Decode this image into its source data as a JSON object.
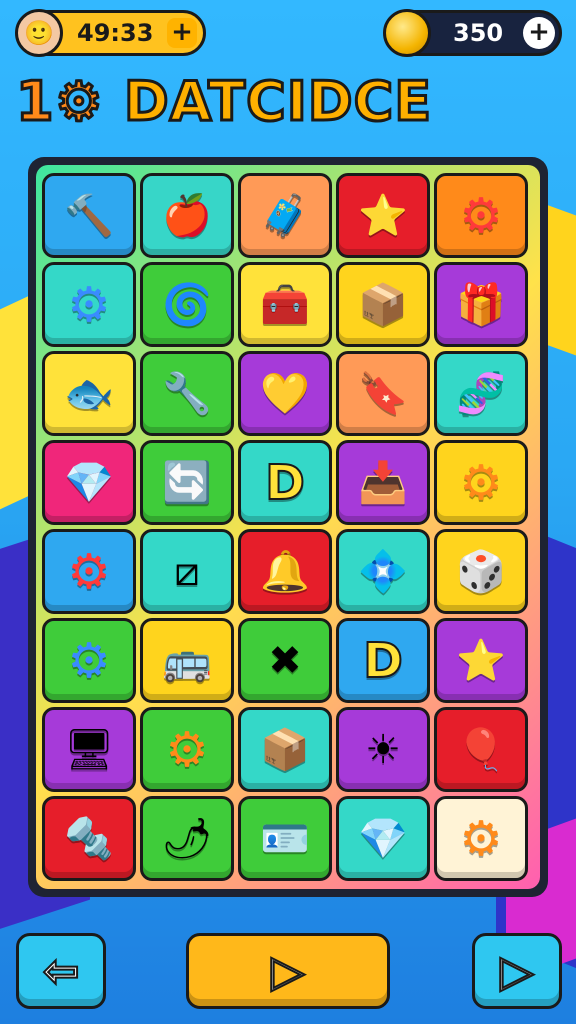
{
  "hud": {
    "timer": "49:33",
    "timer_plus": "+",
    "coins": "350",
    "coins_plus": "+"
  },
  "title": {
    "part1": "1",
    "part2": "DATCIDCE"
  },
  "controls": {
    "back": "⇦",
    "play": "▷",
    "next": "▷"
  },
  "tiles": [
    {
      "color": "#2fa8f0",
      "icon": "🔨",
      "name": "hammer-icon"
    },
    {
      "color": "#37d6c8",
      "icon": "🍎",
      "name": "apple-icon"
    },
    {
      "color": "#ff9a57",
      "icon": "🧳",
      "name": "suitcase-icon"
    },
    {
      "color": "#e61e2a",
      "icon": "⭐",
      "name": "star-gem-icon"
    },
    {
      "color": "#ff8a1a",
      "icon": "⚙",
      "name": "gear-icon"
    },
    {
      "color": "#34d8c8",
      "icon": "⚙",
      "name": "gear-icon"
    },
    {
      "color": "#3fcc3a",
      "icon": "🌀",
      "name": "swirl-icon"
    },
    {
      "color": "#ffe23a",
      "icon": "🧰",
      "name": "toolbox-icon"
    },
    {
      "color": "#ffd41d",
      "icon": "📦",
      "name": "box-icon"
    },
    {
      "color": "#a63ad9",
      "icon": "🎁",
      "name": "gift-icon"
    },
    {
      "color": "#ffe23a",
      "icon": "🐟",
      "name": "fish-icon"
    },
    {
      "color": "#3fcc3a",
      "icon": "🔧",
      "name": "wrench-icon"
    },
    {
      "color": "#a63ad9",
      "icon": "💛",
      "name": "heart-icon"
    },
    {
      "color": "#ff9a57",
      "icon": "🔖",
      "name": "tag-icon"
    },
    {
      "color": "#34d8c8",
      "icon": "🧬",
      "name": "molecule-icon"
    },
    {
      "color": "#f0267a",
      "icon": "💎",
      "name": "gem-icon"
    },
    {
      "color": "#3fcc3a",
      "icon": "🔄",
      "name": "scroll-icon"
    },
    {
      "color": "#34d8c8",
      "icon": "D",
      "name": "letter-d-icon"
    },
    {
      "color": "#a63ad9",
      "icon": "📥",
      "name": "box-lid-icon"
    },
    {
      "color": "#ffd41d",
      "icon": "⚙",
      "name": "gear-icon"
    },
    {
      "color": "#2fa8f0",
      "icon": "⚙",
      "name": "gear-icon"
    },
    {
      "color": "#34d8c8",
      "icon": "⧄",
      "name": "slash-box-icon"
    },
    {
      "color": "#e61e2a",
      "icon": "🔔",
      "name": "bell-icon"
    },
    {
      "color": "#34d8c8",
      "icon": "💠",
      "name": "crystal-icon"
    },
    {
      "color": "#ffd41d",
      "icon": "🎲",
      "name": "dice-icon"
    },
    {
      "color": "#3fcc3a",
      "icon": "⚙",
      "name": "gear-icon"
    },
    {
      "color": "#ffd41d",
      "icon": "🚌",
      "name": "bus-icon"
    },
    {
      "color": "#3fcc3a",
      "icon": "✖",
      "name": "crossed-tools-icon"
    },
    {
      "color": "#2fa8f0",
      "icon": "D",
      "name": "letter-d-icon"
    },
    {
      "color": "#a63ad9",
      "icon": "⭐",
      "name": "star-icon"
    },
    {
      "color": "#a63ad9",
      "icon": "🖥",
      "name": "monitor-icon"
    },
    {
      "color": "#3fcc3a",
      "icon": "⚙",
      "name": "gear-icon"
    },
    {
      "color": "#34d8c8",
      "icon": "📦",
      "name": "chest-icon"
    },
    {
      "color": "#a63ad9",
      "icon": "☀",
      "name": "sun-gear-icon"
    },
    {
      "color": "#e61e2a",
      "icon": "🎈",
      "name": "balloon-icon"
    },
    {
      "color": "#e61e2a",
      "icon": "🔩",
      "name": "key-icon"
    },
    {
      "color": "#3fcc3a",
      "icon": "🌶",
      "name": "pepper-icon"
    },
    {
      "color": "#3fcc3a",
      "icon": "🪪",
      "name": "card-icon"
    },
    {
      "color": "#34d8c8",
      "icon": "💎",
      "name": "ruby-icon"
    },
    {
      "color": "#fff3d6",
      "icon": "⚙",
      "name": "gear-icon"
    }
  ]
}
